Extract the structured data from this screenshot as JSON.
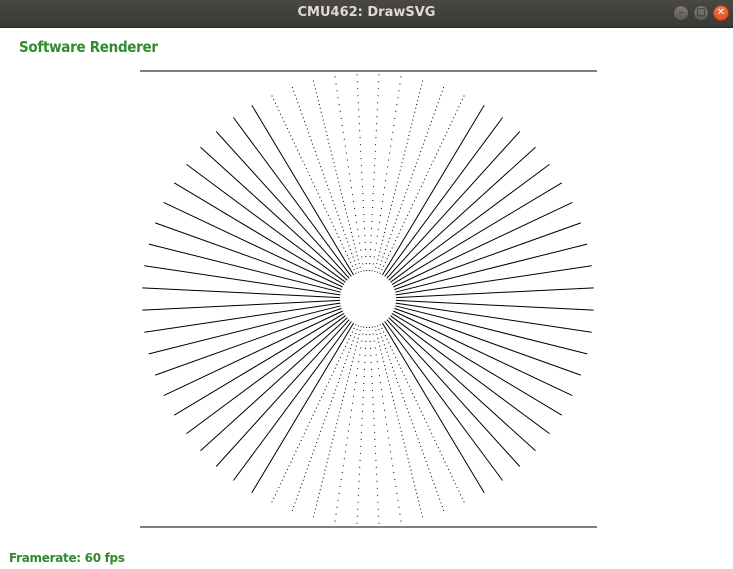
{
  "window": {
    "title": "CMU462: DrawSVG",
    "controls": [
      "minimize",
      "maximize",
      "close"
    ]
  },
  "renderer_label": "Software Renderer",
  "framerate_label": "Framerate: 60 fps",
  "canvas": {
    "drawing": "radial lines test pattern",
    "line_color": "#000000",
    "background": "#ffffff",
    "text_color": "#2e8b2e"
  }
}
